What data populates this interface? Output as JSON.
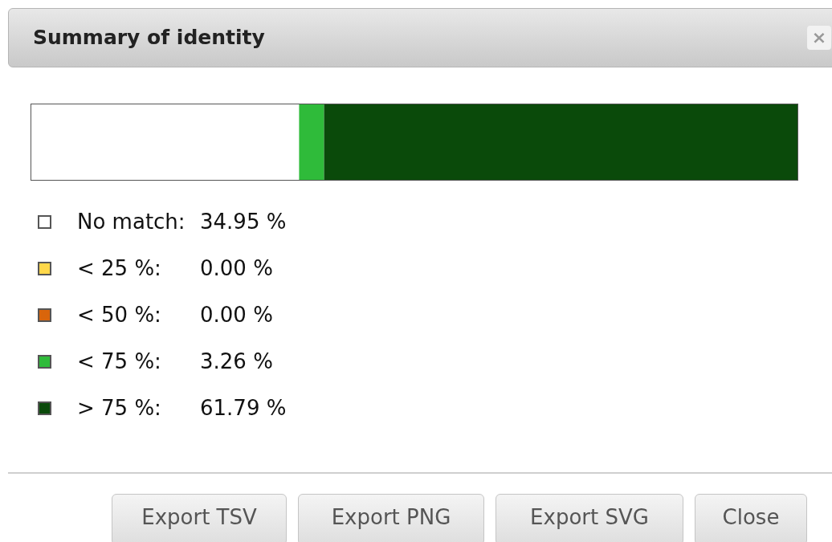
{
  "dialog": {
    "title": "Summary of identity",
    "close_icon": "×"
  },
  "legend": [
    {
      "label": "No match:",
      "value": "34.95 %",
      "color": "#ffffff"
    },
    {
      "label": "< 25 %:",
      "value": "0.00 %",
      "color": "#ffd84a"
    },
    {
      "label": "< 50 %:",
      "value": "0.00 %",
      "color": "#d9650b"
    },
    {
      "label": "< 75 %:",
      "value": "3.26 %",
      "color": "#2fbb3a"
    },
    {
      "label": "> 75 %:",
      "value": "61.79 %",
      "color": "#0a4a0a"
    }
  ],
  "buttons": [
    "Export TSV",
    "Export PNG",
    "Export SVG",
    "Close"
  ]
}
